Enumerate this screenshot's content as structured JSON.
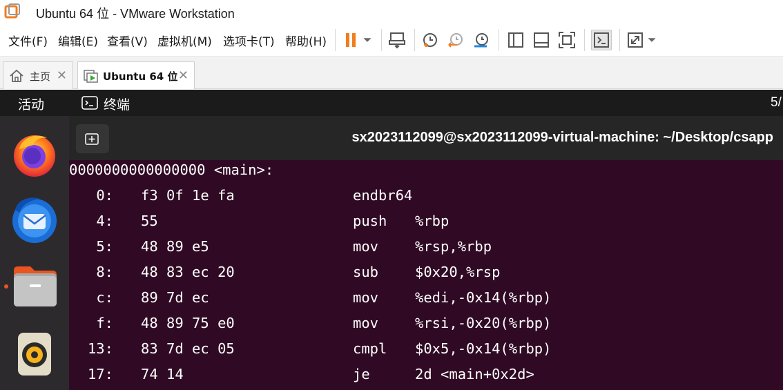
{
  "window": {
    "title": "Ubuntu 64 位 - VMware Workstation"
  },
  "menu": [
    "文件(F)",
    "编辑(E)",
    "查看(V)",
    "虚拟机(M)",
    "选项卡(T)",
    "帮助(H)"
  ],
  "tabs": [
    {
      "label": "主页"
    },
    {
      "label": "Ubuntu 64 位"
    }
  ],
  "ubuntu_bar": {
    "activities": "活动",
    "app_label": "终端",
    "clock": "5/"
  },
  "terminal": {
    "title": "sx2023112099@sx2023112099-virtual-machine: ~/Desktop/csapp",
    "header_line": "0000000000000000 <main>:",
    "lines": [
      {
        "addr": "0:",
        "bytes": "f3 0f 1e fa",
        "mnemonic": "endbr64",
        "operands": ""
      },
      {
        "addr": "4:",
        "bytes": "55",
        "mnemonic": "push",
        "operands": "%rbp"
      },
      {
        "addr": "5:",
        "bytes": "48 89 e5",
        "mnemonic": "mov",
        "operands": "%rsp,%rbp"
      },
      {
        "addr": "8:",
        "bytes": "48 83 ec 20",
        "mnemonic": "sub",
        "operands": "$0x20,%rsp"
      },
      {
        "addr": "c:",
        "bytes": "89 7d ec",
        "mnemonic": "mov",
        "operands": "%edi,-0x14(%rbp)"
      },
      {
        "addr": "f:",
        "bytes": "48 89 75 e0",
        "mnemonic": "mov",
        "operands": "%rsi,-0x20(%rbp)"
      },
      {
        "addr": "13:",
        "bytes": "83 7d ec 05",
        "mnemonic": "cmpl",
        "operands": "$0x5,-0x14(%rbp)"
      },
      {
        "addr": "17:",
        "bytes": "74 14",
        "mnemonic": "je",
        "operands": "2d <main+0x2d>"
      }
    ]
  },
  "colors": {
    "accent": "#f07e1f",
    "terminal_bg": "#300a24",
    "dock_bg": "#2d2a2e",
    "ubuntu_bar": "#1b1b1b"
  },
  "icons": {
    "toolbar": [
      "pause-icon",
      "dropdown-icon",
      "send-ctrl-alt-del-icon",
      "snapshot-icon",
      "revert-snapshot-icon",
      "snapshot-manager-icon",
      "library-icon",
      "thumbnail-bar-icon",
      "full-screen-icon",
      "console-view-icon",
      "stretch-icon"
    ],
    "dock": [
      "firefox-icon",
      "thunderbird-icon",
      "files-icon",
      "rhythmbox-icon"
    ]
  }
}
